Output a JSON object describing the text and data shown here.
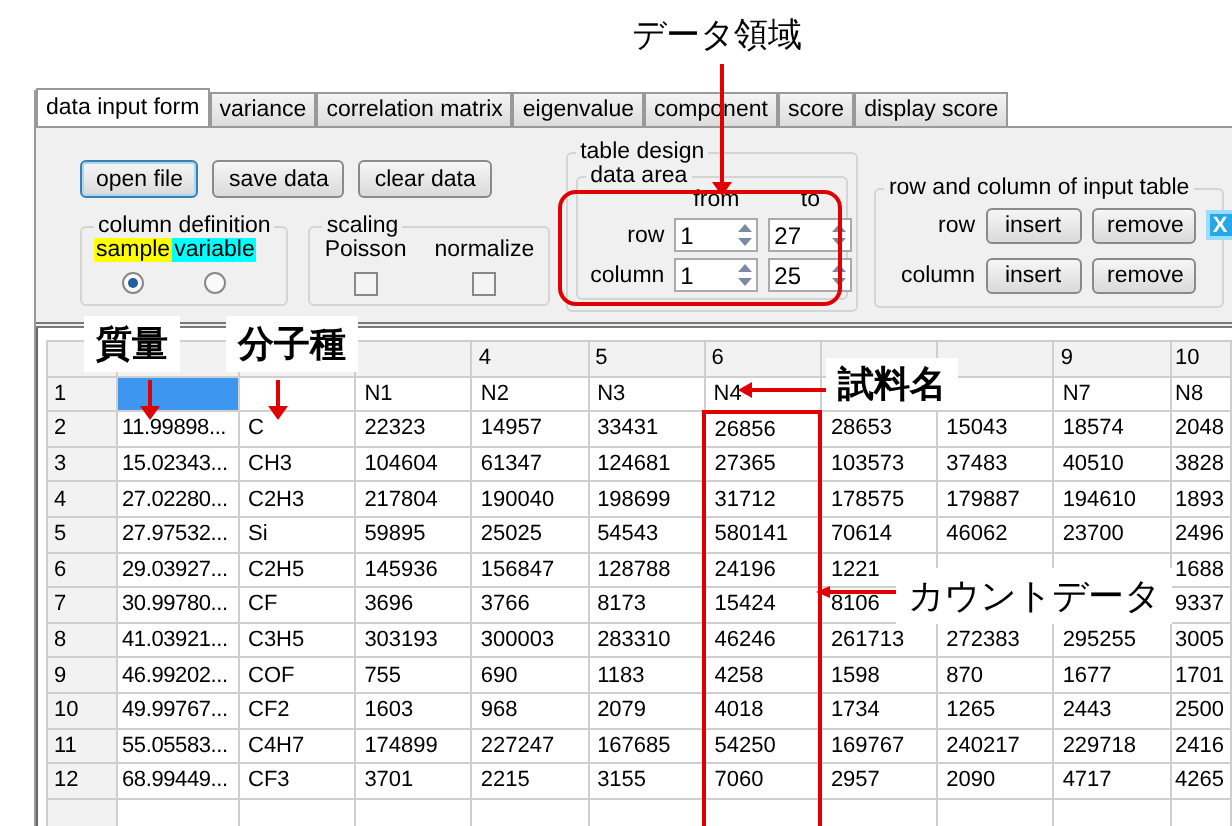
{
  "annotations": {
    "title": "データ領域",
    "mass": "質量",
    "species": "分子種",
    "sample_name": "試料名",
    "count_data": "カウントデータ"
  },
  "tabs": [
    {
      "label": "data input form",
      "selected": true
    },
    {
      "label": "variance",
      "selected": false
    },
    {
      "label": "correlation matrix",
      "selected": false
    },
    {
      "label": "eigenvalue",
      "selected": false
    },
    {
      "label": "component",
      "selected": false
    },
    {
      "label": "score",
      "selected": false
    },
    {
      "label": "display score",
      "selected": false
    }
  ],
  "buttons": [
    {
      "label": "open file",
      "focused": true
    },
    {
      "label": "save data",
      "focused": false
    },
    {
      "label": "clear data",
      "focused": false
    }
  ],
  "column_definition": {
    "title": "column definition",
    "options": [
      {
        "label": "sample",
        "color": "#ffff00",
        "selected": true
      },
      {
        "label": "variable",
        "color": "#00ffff",
        "selected": false
      }
    ]
  },
  "scaling": {
    "title": "scaling",
    "options": [
      {
        "label": "Poisson",
        "checked": false
      },
      {
        "label": "normalize",
        "checked": false
      }
    ]
  },
  "table_design": {
    "title": "table design",
    "data_area": {
      "title": "data area",
      "headers": [
        "from",
        "to"
      ],
      "rows": [
        {
          "label": "row",
          "from": "1",
          "to": "27"
        },
        {
          "label": "column",
          "from": "1",
          "to": "25"
        }
      ]
    }
  },
  "input_table": {
    "title": "row and column of input table",
    "rows": [
      {
        "label": "row",
        "buttons": [
          "insert",
          "remove"
        ]
      },
      {
        "label": "column",
        "buttons": [
          "insert",
          "remove"
        ]
      }
    ],
    "close_label": "X"
  },
  "table": {
    "columns": [
      null,
      null,
      null,
      "4",
      "5",
      "6",
      null,
      null,
      "9",
      "10"
    ],
    "rows": [
      {
        "label": "1",
        "cells": [
          {
            "selected": true
          },
          {
            "selected": false
          },
          {
            "text": "N1",
            "selected": false
          },
          {
            "text": "N2",
            "selected": false
          },
          {
            "text": "N3",
            "selected": false
          },
          {
            "text": "N4",
            "selected": false
          },
          null,
          null,
          {
            "text": "N7",
            "selected": false
          },
          {
            "text": "N8",
            "selected": false
          }
        ]
      },
      {
        "label": "2",
        "cells": [
          {
            "text": "11.99898...",
            "selected": false
          },
          {
            "text": "C",
            "selected": false
          },
          {
            "text": "22323",
            "selected": false
          },
          {
            "text": "14957",
            "selected": false
          },
          {
            "text": "33431",
            "selected": false
          },
          {
            "text": "26856",
            "selected": false
          },
          {
            "text": "28653",
            "selected": false
          },
          {
            "text": "15043",
            "selected": false
          },
          {
            "text": "18574",
            "selected": false
          },
          {
            "text": "2048",
            "selected": false
          }
        ]
      },
      {
        "label": "3",
        "cells": [
          {
            "text": "15.02343...",
            "selected": false
          },
          {
            "text": "CH3",
            "selected": false
          },
          {
            "text": "104604",
            "selected": false
          },
          {
            "text": "61347",
            "selected": false
          },
          {
            "text": "124681",
            "selected": false
          },
          {
            "text": "27365",
            "selected": false
          },
          {
            "text": "103573",
            "selected": false
          },
          {
            "text": "37483",
            "selected": false
          },
          {
            "text": "40510",
            "selected": false
          },
          {
            "text": "3828",
            "selected": false
          }
        ]
      },
      {
        "label": "4",
        "cells": [
          {
            "text": "27.02280...",
            "selected": false
          },
          {
            "text": "C2H3",
            "selected": false
          },
          {
            "text": "217804",
            "selected": false
          },
          {
            "text": "190040",
            "selected": false
          },
          {
            "text": "198699",
            "selected": false
          },
          {
            "text": "31712",
            "selected": false
          },
          {
            "text": "178575",
            "selected": false
          },
          {
            "text": "179887",
            "selected": false
          },
          {
            "text": "194610",
            "selected": false
          },
          {
            "text": "1893",
            "selected": false
          }
        ]
      },
      {
        "label": "5",
        "cells": [
          {
            "text": "27.97532...",
            "selected": false
          },
          {
            "text": "Si",
            "selected": false
          },
          {
            "text": "59895",
            "selected": false
          },
          {
            "text": "25025",
            "selected": false
          },
          {
            "text": "54543",
            "selected": false
          },
          {
            "text": "580141",
            "selected": false
          },
          {
            "text": "70614",
            "selected": false
          },
          {
            "text": "46062",
            "selected": false
          },
          {
            "text": "23700",
            "selected": false
          },
          {
            "text": "2496",
            "selected": false
          }
        ]
      },
      {
        "label": "6",
        "cells": [
          {
            "text": "29.03927...",
            "selected": false
          },
          {
            "text": "C2H5",
            "selected": false
          },
          {
            "text": "145936",
            "selected": false
          },
          {
            "text": "156847",
            "selected": false
          },
          {
            "text": "128788",
            "selected": false
          },
          {
            "text": "24196",
            "selected": false
          },
          {
            "text": "1221",
            "selected": false
          },
          null,
          null,
          {
            "text": "1688",
            "selected": false
          }
        ]
      },
      {
        "label": "7",
        "cells": [
          {
            "text": "30.99780...",
            "selected": false
          },
          {
            "text": "CF",
            "selected": false
          },
          {
            "text": "3696",
            "selected": false
          },
          {
            "text": "3766",
            "selected": false
          },
          {
            "text": "8173",
            "selected": false
          },
          {
            "text": "15424",
            "selected": false
          },
          {
            "text": "8106",
            "selected": false
          },
          null,
          null,
          {
            "text": "9337",
            "selected": false
          }
        ]
      },
      {
        "label": "8",
        "cells": [
          {
            "text": "41.03921...",
            "selected": false
          },
          {
            "text": "C3H5",
            "selected": false
          },
          {
            "text": "303193",
            "selected": false
          },
          {
            "text": "300003",
            "selected": false
          },
          {
            "text": "283310",
            "selected": false
          },
          {
            "text": "46246",
            "selected": false
          },
          {
            "text": "261713",
            "selected": false
          },
          {
            "text": "272383",
            "selected": false
          },
          {
            "text": "295255",
            "selected": false
          },
          {
            "text": "3005",
            "selected": false
          }
        ]
      },
      {
        "label": "9",
        "cells": [
          {
            "text": "46.99202...",
            "selected": false
          },
          {
            "text": "COF",
            "selected": false
          },
          {
            "text": "755",
            "selected": false
          },
          {
            "text": "690",
            "selected": false
          },
          {
            "text": "1183",
            "selected": false
          },
          {
            "text": "4258",
            "selected": false
          },
          {
            "text": "1598",
            "selected": false
          },
          {
            "text": "870",
            "selected": false
          },
          {
            "text": "1677",
            "selected": false
          },
          {
            "text": "1701",
            "selected": false
          }
        ]
      },
      {
        "label": "10",
        "cells": [
          {
            "text": "49.99767...",
            "selected": false
          },
          {
            "text": "CF2",
            "selected": false
          },
          {
            "text": "1603",
            "selected": false
          },
          {
            "text": "968",
            "selected": false
          },
          {
            "text": "2079",
            "selected": false
          },
          {
            "text": "4018",
            "selected": false
          },
          {
            "text": "1734",
            "selected": false
          },
          {
            "text": "1265",
            "selected": false
          },
          {
            "text": "2443",
            "selected": false
          },
          {
            "text": "2500",
            "selected": false
          }
        ]
      },
      {
        "label": "11",
        "cells": [
          {
            "text": "55.05583...",
            "selected": false
          },
          {
            "text": "C4H7",
            "selected": false
          },
          {
            "text": "174899",
            "selected": false
          },
          {
            "text": "227247",
            "selected": false
          },
          {
            "text": "167685",
            "selected": false
          },
          {
            "text": "54250",
            "selected": false
          },
          {
            "text": "169767",
            "selected": false
          },
          {
            "text": "240217",
            "selected": false
          },
          {
            "text": "229718",
            "selected": false
          },
          {
            "text": "2416",
            "selected": false
          }
        ]
      },
      {
        "label": "12",
        "cells": [
          {
            "text": "68.99449...",
            "selected": false
          },
          {
            "text": "CF3",
            "selected": false
          },
          {
            "text": "3701",
            "selected": false
          },
          {
            "text": "2215",
            "selected": false
          },
          {
            "text": "3155",
            "selected": false
          },
          {
            "text": "7060",
            "selected": false
          },
          {
            "text": "2957",
            "selected": false
          },
          {
            "text": "2090",
            "selected": false
          },
          {
            "text": "4717",
            "selected": false
          },
          {
            "text": "4265",
            "selected": false
          }
        ]
      }
    ]
  }
}
